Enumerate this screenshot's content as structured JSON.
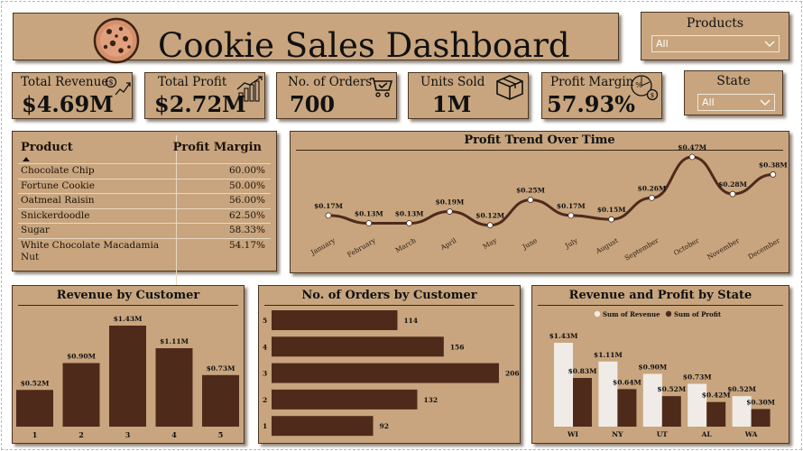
{
  "header": {
    "title": "Cookie Sales Dashboard",
    "logo": "cookie-icon"
  },
  "kpis": [
    {
      "label": "Total Revenue",
      "value": "$4.69M",
      "icon": "money-growth-icon"
    },
    {
      "label": "Total Profit",
      "value": "$2.72M",
      "icon": "bar-growth-icon"
    },
    {
      "label": "No. of Orders",
      "value": "700",
      "icon": "cart-icon"
    },
    {
      "label": "Units Sold",
      "value": "1M",
      "icon": "box-icon"
    },
    {
      "label": "Profit Margin",
      "value": "57.93%",
      "icon": "percent-coin-icon"
    }
  ],
  "slicers": {
    "products": {
      "title": "Products",
      "value": "All"
    },
    "state": {
      "title": "State",
      "value": "All"
    }
  },
  "product_table": {
    "headers": [
      "Product",
      "Profit Margin"
    ],
    "rows": [
      {
        "product": "Chocolate Chip",
        "margin": "60.00%"
      },
      {
        "product": "Fortune Cookie",
        "margin": "50.00%"
      },
      {
        "product": "Oatmeal Raisin",
        "margin": "56.00%"
      },
      {
        "product": "Snickerdoodle",
        "margin": "62.50%"
      },
      {
        "product": "Sugar",
        "margin": "58.33%"
      },
      {
        "product": "White Chocolate Macadamia Nut",
        "margin": "54.17%"
      }
    ]
  },
  "colors": {
    "panel": "#c8a57e",
    "bar": "#4e2a1b",
    "light_bar": "#f0ebe6",
    "line": "#4e2a1b"
  },
  "chart_data": [
    {
      "type": "line",
      "title": "Profit Trend Over Time",
      "categories": [
        "January",
        "February",
        "March",
        "April",
        "May",
        "June",
        "July",
        "August",
        "September",
        "October",
        "November",
        "December"
      ],
      "values": [
        0.17,
        0.13,
        0.13,
        0.19,
        0.12,
        0.25,
        0.17,
        0.15,
        0.26,
        0.47,
        0.28,
        0.38
      ],
      "labels": [
        "$0.17M",
        "$0.13M",
        "$0.13M",
        "$0.19M",
        "$0.12M",
        "$0.25M",
        "$0.17M",
        "$0.15M",
        "$0.26M",
        "$0.47M",
        "$0.28M",
        "$0.38M"
      ]
    },
    {
      "type": "bar",
      "title": "Revenue by Customer",
      "categories": [
        "1",
        "2",
        "3",
        "4",
        "5"
      ],
      "values": [
        0.52,
        0.9,
        1.43,
        1.11,
        0.73
      ],
      "labels": [
        "$0.52M",
        "$0.90M",
        "$1.43M",
        "$1.11M",
        "$0.73M"
      ]
    },
    {
      "type": "bar",
      "orientation": "horizontal",
      "title": "No. of Orders by Customer",
      "categories": [
        "5",
        "4",
        "3",
        "2",
        "1"
      ],
      "values": [
        114,
        156,
        206,
        132,
        92
      ]
    },
    {
      "type": "bar",
      "title": "Revenue and Profit by State",
      "categories": [
        "WI",
        "NY",
        "UT",
        "AL",
        "WA"
      ],
      "series": [
        {
          "name": "Sum of Revenue",
          "values": [
            1.43,
            1.11,
            0.9,
            0.73,
            0.52
          ],
          "labels": [
            "$1.43M",
            "$1.11M",
            "$0.90M",
            "$0.73M",
            "$0.52M"
          ]
        },
        {
          "name": "Sum of Profit",
          "values": [
            0.83,
            0.64,
            0.52,
            0.42,
            0.3
          ],
          "labels": [
            "$0.83M",
            "$0.64M",
            "$0.52M",
            "$0.42M",
            "$0.30M"
          ]
        }
      ],
      "legend": "top"
    }
  ]
}
